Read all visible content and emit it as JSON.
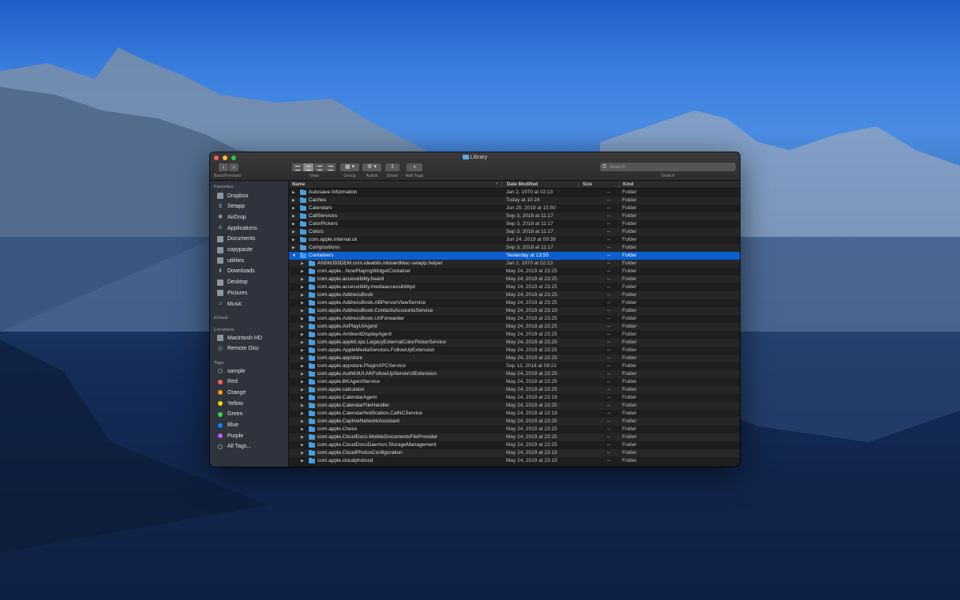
{
  "window": {
    "title": "Library"
  },
  "toolbar": {
    "back_forward_label": "Back/Forward",
    "view_label": "View",
    "group_label": "Group",
    "action_label": "Action",
    "share_label": "Share",
    "add_tags_label": "Add Tags",
    "search_label": "Search",
    "search_placeholder": "Search"
  },
  "sidebar": {
    "favorites_header": "Favorites",
    "favorites": [
      {
        "label": "Dropbox",
        "icon": "dropbox-icon"
      },
      {
        "label": "Setapp",
        "icon": "setapp-icon"
      },
      {
        "label": "AirDrop",
        "icon": "airdrop-icon"
      },
      {
        "label": "Applications",
        "icon": "applications-icon"
      },
      {
        "label": "Documents",
        "icon": "document-icon"
      },
      {
        "label": "copypaste",
        "icon": "folder-icon"
      },
      {
        "label": "utilities",
        "icon": "folder-icon"
      },
      {
        "label": "Downloads",
        "icon": "downloads-icon"
      },
      {
        "label": "Desktop",
        "icon": "desktop-icon"
      },
      {
        "label": "Pictures",
        "icon": "pictures-icon"
      },
      {
        "label": "Music",
        "icon": "music-icon"
      }
    ],
    "icloud_header": "iCloud",
    "locations_header": "Locations",
    "locations": [
      {
        "label": "Macintosh HD",
        "icon": "harddisk-icon"
      },
      {
        "label": "Remote Disc",
        "icon": "disc-icon"
      }
    ],
    "tags_header": "Tags",
    "tags": [
      {
        "label": "sample",
        "color": "#3a3f4a"
      },
      {
        "label": "Red",
        "color": "#ff5f57"
      },
      {
        "label": "Orange",
        "color": "#ff9f0a"
      },
      {
        "label": "Yellow",
        "color": "#ffd60a"
      },
      {
        "label": "Green",
        "color": "#32d74b"
      },
      {
        "label": "Blue",
        "color": "#0a84ff"
      },
      {
        "label": "Purple",
        "color": "#bf5af2"
      },
      {
        "label": "All Tags...",
        "color": "#3a3f4a"
      }
    ]
  },
  "columns": {
    "name": "Name",
    "date": "Date Modified",
    "size": "Size",
    "kind": "Kind"
  },
  "rows": [
    {
      "name": "Autosave Information",
      "date": "Jan 2, 1970 at 02:13",
      "size": "--",
      "kind": "Folder",
      "level": 0,
      "expanded": false
    },
    {
      "name": "Caches",
      "date": "Today at 10:24",
      "size": "--",
      "kind": "Folder",
      "level": 0,
      "expanded": false
    },
    {
      "name": "Calendars",
      "date": "Jun 25, 2019 at 15:50",
      "size": "--",
      "kind": "Folder",
      "level": 0,
      "expanded": false
    },
    {
      "name": "CallServices",
      "date": "Sep 3, 2018 at 11:17",
      "size": "--",
      "kind": "Folder",
      "level": 0,
      "expanded": false
    },
    {
      "name": "ColorPickers",
      "date": "Sep 3, 2018 at 11:17",
      "size": "--",
      "kind": "Folder",
      "level": 0,
      "expanded": false
    },
    {
      "name": "Colors",
      "date": "Sep 3, 2018 at 11:17",
      "size": "--",
      "kind": "Folder",
      "level": 0,
      "expanded": false
    },
    {
      "name": "com.apple.internal.ck",
      "date": "Jun 24, 2019 at 09:39",
      "size": "--",
      "kind": "Folder",
      "level": 0,
      "expanded": false
    },
    {
      "name": "Compositions",
      "date": "Sep 3, 2018 at 11:17",
      "size": "--",
      "kind": "Folder",
      "level": 0,
      "expanded": false
    },
    {
      "name": "Containers",
      "date": "Yesterday at 13:55",
      "size": "--",
      "kind": "Folder",
      "level": 0,
      "expanded": true,
      "selected": true
    },
    {
      "name": "AN5MJ93DEM.com.ideabits.inboardMac-setapp.helper",
      "date": "Jan 2, 1970 at 02:13",
      "size": "--",
      "kind": "Folder",
      "level": 1
    },
    {
      "name": "com.apple...NowPlayingWidgetContainer",
      "date": "May 24, 2019 at 23:25",
      "size": "--",
      "kind": "Folder",
      "level": 1
    },
    {
      "name": "com.apple.accessibility.heard",
      "date": "May 24, 2019 at 23:25",
      "size": "--",
      "kind": "Folder",
      "level": 1
    },
    {
      "name": "com.apple.accessibility.mediaaccessibilityd",
      "date": "May 24, 2019 at 23:25",
      "size": "--",
      "kind": "Folder",
      "level": 1
    },
    {
      "name": "com.apple.AddressBook",
      "date": "May 24, 2019 at 23:25",
      "size": "--",
      "kind": "Folder",
      "level": 1
    },
    {
      "name": "com.apple.AddressBook.ABPersonViewService",
      "date": "May 24, 2019 at 23:25",
      "size": "--",
      "kind": "Folder",
      "level": 1
    },
    {
      "name": "com.apple.AddressBook.ContactsAccountsService",
      "date": "May 24, 2019 at 23:19",
      "size": "--",
      "kind": "Folder",
      "level": 1
    },
    {
      "name": "com.apple.AddressBook.UrlForwarder",
      "date": "May 24, 2019 at 23:25",
      "size": "--",
      "kind": "Folder",
      "level": 1
    },
    {
      "name": "com.apple.AirPlayUIAgent",
      "date": "May 24, 2019 at 23:25",
      "size": "--",
      "kind": "Folder",
      "level": 1
    },
    {
      "name": "com.apple.AmbientDisplayAgent",
      "date": "May 24, 2019 at 23:25",
      "size": "--",
      "kind": "Folder",
      "level": 1
    },
    {
      "name": "com.apple.appkit.xpc.LegacyExternalColorPickerService",
      "date": "May 24, 2019 at 23:25",
      "size": "--",
      "kind": "Folder",
      "level": 1
    },
    {
      "name": "com.apple.AppleMediaServices.FollowUpExtension",
      "date": "May 24, 2019 at 23:25",
      "size": "--",
      "kind": "Folder",
      "level": 1
    },
    {
      "name": "com.apple.appstore",
      "date": "May 24, 2019 at 23:25",
      "size": "--",
      "kind": "Folder",
      "level": 1
    },
    {
      "name": "com.apple.appstore.PluginXPCService",
      "date": "Sep 12, 2018 at 09:22",
      "size": "--",
      "kind": "Folder",
      "level": 1
    },
    {
      "name": "com.apple.AuthKitUI.AKFollowUpServerUIExtension",
      "date": "May 24, 2019 at 23:25",
      "size": "--",
      "kind": "Folder",
      "level": 1
    },
    {
      "name": "com.apple.BKAgentService",
      "date": "May 24, 2019 at 23:25",
      "size": "--",
      "kind": "Folder",
      "level": 1
    },
    {
      "name": "com.apple.calculator",
      "date": "May 24, 2019 at 23:25",
      "size": "--",
      "kind": "Folder",
      "level": 1
    },
    {
      "name": "com.apple.CalendarAgent",
      "date": "May 24, 2019 at 23:19",
      "size": "--",
      "kind": "Folder",
      "level": 1
    },
    {
      "name": "com.apple.CalendarFileHandler",
      "date": "May 24, 2019 at 23:25",
      "size": "--",
      "kind": "Folder",
      "level": 1
    },
    {
      "name": "com.apple.CalendarNotification.CalNCService",
      "date": "May 24, 2019 at 23:19",
      "size": "--",
      "kind": "Folder",
      "level": 1
    },
    {
      "name": "com.apple.CaptiveNetworkAssistant",
      "date": "May 24, 2019 at 23:25",
      "size": "--",
      "kind": "Folder",
      "level": 1
    },
    {
      "name": "com.apple.Chess",
      "date": "May 24, 2019 at 23:25",
      "size": "--",
      "kind": "Folder",
      "level": 1
    },
    {
      "name": "com.apple.CloudDocs.MobileDocumentsFileProvider",
      "date": "May 24, 2019 at 23:25",
      "size": "--",
      "kind": "Folder",
      "level": 1
    },
    {
      "name": "com.apple.CloudDocsDaemon.StorageManagement",
      "date": "May 24, 2019 at 23:25",
      "size": "--",
      "kind": "Folder",
      "level": 1
    },
    {
      "name": "com.apple.CloudPhotosConfiguration",
      "date": "May 24, 2019 at 23:19",
      "size": "--",
      "kind": "Folder",
      "level": 1
    },
    {
      "name": "com.apple.cloudphotosd",
      "date": "May 24, 2019 at 23:19",
      "size": "--",
      "kind": "Folder",
      "level": 1
    }
  ]
}
